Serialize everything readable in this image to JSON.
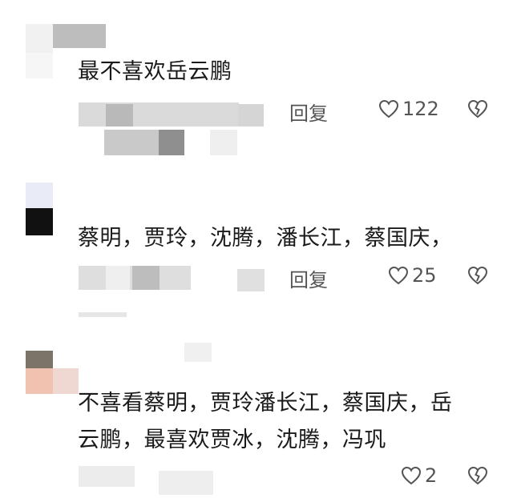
{
  "comments": [
    {
      "text": "最不喜欢岳云鹏",
      "reply_label": "回复",
      "likes": "122"
    },
    {
      "text": "蔡明，贾玲，沈腾，潘长江，蔡国庆，",
      "reply_label": "回复",
      "likes": "25"
    },
    {
      "text_line1": "不喜看蔡明，贾玲潘长江，蔡国庆，岳",
      "text_line2": "云鹏，最喜欢贾冰，沈腾，冯巩",
      "likes": "2"
    }
  ],
  "icons": {
    "like": "heart-outline-icon",
    "dislike": "broken-heart-icon"
  },
  "colors": {
    "text": "#1a1a1a",
    "meta": "#555555",
    "icon": "#555555"
  }
}
